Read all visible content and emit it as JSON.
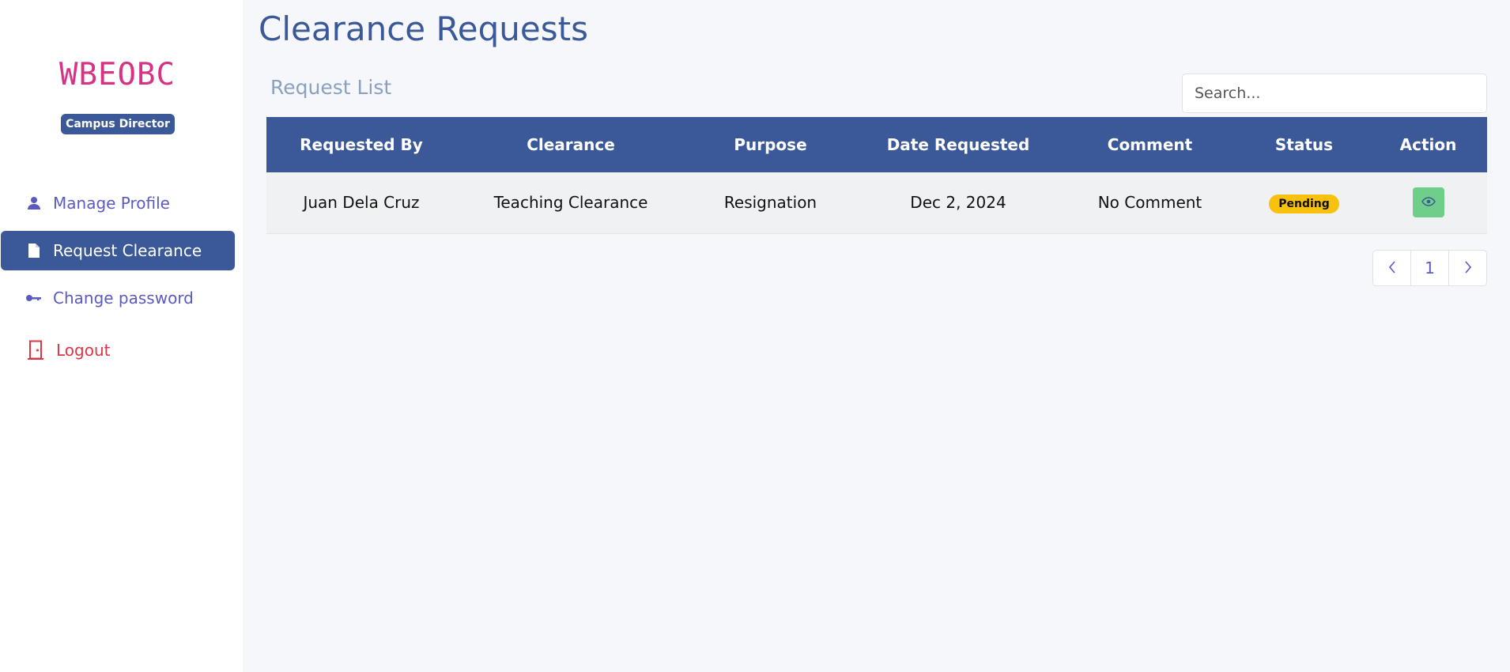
{
  "sidebar": {
    "brand": "WBEOBC",
    "role": "Campus Director",
    "items": [
      {
        "label": "Manage Profile"
      },
      {
        "label": "Request Clearance"
      },
      {
        "label": "Change password"
      },
      {
        "label": "Logout"
      }
    ]
  },
  "main": {
    "title": "Clearance Requests",
    "list_title": "Request List",
    "search": {
      "placeholder": "Search..."
    },
    "table": {
      "headers": [
        "Requested By",
        "Clearance",
        "Purpose",
        "Date Requested",
        "Comment",
        "Status",
        "Action"
      ],
      "rows": [
        {
          "requested_by": "Juan Dela Cruz",
          "clearance": "Teaching Clearance",
          "purpose": "Resignation",
          "date_requested": "Dec 2, 2024",
          "comment": "No Comment",
          "status": "Pending"
        }
      ]
    },
    "pagination": {
      "prev": "‹",
      "page": "1",
      "next": "›"
    }
  },
  "colors": {
    "accent": "#3b5998",
    "brand": "#d63384",
    "nav": "#5a5bc0",
    "logout": "#dc3545",
    "pending": "#f8c10d",
    "view_button": "#6fcf8a"
  },
  "icons": {
    "manage_profile": "user-icon",
    "request_clearance": "document-icon",
    "change_password": "key-icon",
    "logout": "door-icon",
    "view": "eye-icon"
  }
}
